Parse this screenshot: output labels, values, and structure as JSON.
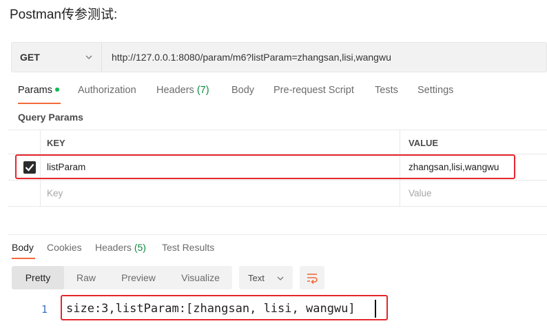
{
  "heading": "Postman传参测试:",
  "request": {
    "method": "GET",
    "url": "http://127.0.0.1:8080/param/m6?listParam=zhangsan,lisi,wangwu"
  },
  "request_tabs": {
    "params": "Params",
    "authorization": "Authorization",
    "headers": "Headers",
    "headers_count": "(7)",
    "body": "Body",
    "prerequest": "Pre-request Script",
    "tests": "Tests",
    "settings": "Settings"
  },
  "query_params": {
    "title": "Query Params",
    "columns": {
      "key": "KEY",
      "value": "VALUE"
    },
    "rows": [
      {
        "key": "listParam",
        "value": "zhangsan,lisi,wangwu",
        "checked": true
      }
    ],
    "placeholder": {
      "key": "Key",
      "value": "Value"
    }
  },
  "response_tabs": {
    "body": "Body",
    "cookies": "Cookies",
    "headers": "Headers",
    "headers_count": "(5)",
    "test_results": "Test Results"
  },
  "toolbar": {
    "pretty": "Pretty",
    "raw": "Raw",
    "preview": "Preview",
    "visualize": "Visualize",
    "format": "Text"
  },
  "response_body": {
    "line_number": "1",
    "content": "size:3,listParam:[zhangsan, lisi, wangwu]"
  },
  "colors": {
    "accent": "#f26b3a",
    "highlight": "#e5262c",
    "active_dot": "#0cbb52"
  }
}
